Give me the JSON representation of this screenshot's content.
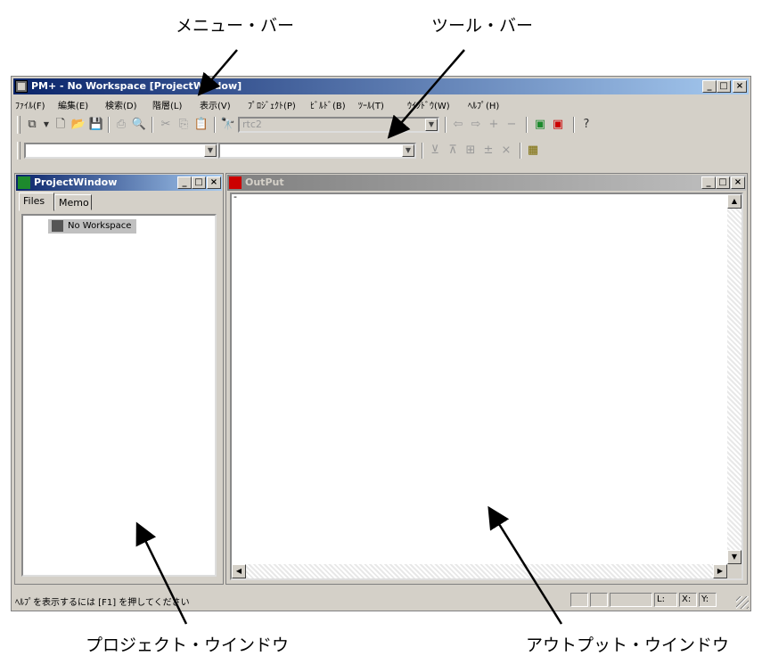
{
  "callouts": {
    "menu_bar": "メニュー・バー",
    "tool_bar": "ツール・バー",
    "project_window": "プロジェクト・ウインドウ",
    "output_window": "アウトプット・ウインドウ"
  },
  "window": {
    "title": "PM+ - No Workspace  [ProjectWindow]",
    "minimize": "_",
    "maximize": "□",
    "close": "×"
  },
  "menu": {
    "items": [
      "ﾌｧｲﾙ(F)",
      "編集(E)",
      "検索(D)",
      "階層(L)",
      "表示(V)",
      "ﾌﾟﾛｼﾞｪｸﾄ(P)",
      "ﾋﾞﾙﾄﾞ(B)",
      "ﾂｰﾙ(T)",
      "ｳｲﾝﾄﾞｳ(W)",
      "ﾍﾙﾌﾟ(H)"
    ]
  },
  "toolbar": {
    "project_combo": "rtc2"
  },
  "project_panel": {
    "title": "ProjectWindow",
    "tabs": [
      "Files",
      "Memo"
    ],
    "tree_item": "No Workspace"
  },
  "output_panel": {
    "title": "OutPut",
    "text": "-"
  },
  "status": {
    "help_text": "ﾍﾙﾌﾟを表示するには [F1] を押してください",
    "line_label": "L:",
    "x_label": "X:",
    "y_label": "Y:"
  },
  "colors": {
    "title_active": "#0a246a",
    "title_gradient_end": "#a6caf0",
    "face": "#d4d0c8"
  }
}
